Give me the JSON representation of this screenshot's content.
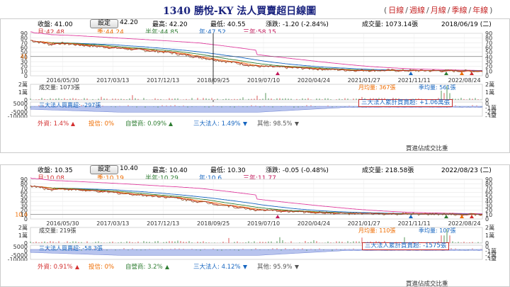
{
  "page": {
    "title": "1340 勝悅-KY 法人買賣超日線圖",
    "timeframes": [
      "日線",
      "週線",
      "月線",
      "季線",
      "年線"
    ]
  },
  "panels": [
    {
      "info": {
        "close": "收盤: 41.00",
        "open_value": "42.20",
        "high": "最高: 42.20",
        "low": "最低: 40.55",
        "change": "漲跌: -1.20 (-2.84%)",
        "volume": "成交量: 1073.14張",
        "date": "2018/06/19 (二)"
      },
      "ma": {
        "month": "月:42.48",
        "quarter": "季:44.24",
        "half": "半年:44.85",
        "year": "年:47.52",
        "three_year": "三年:58.15"
      },
      "price_label": "41",
      "y_ticks": [
        "90",
        "80",
        "70",
        "60",
        "50",
        "40",
        "30",
        "20",
        "10",
        "0"
      ],
      "dates": [
        "2016/05/30",
        "2017/03/13",
        "2017/12/13",
        "2018/09/25",
        "2019/07/10",
        "2020/04/24",
        "2021/01/27",
        "2021/11/11",
        "2022/08/24"
      ],
      "vol": {
        "label": "成交量: 1073張",
        "month_avg": "月均量: 367張",
        "quarter_avg": "季均量: 561張",
        "y": [
          "2萬",
          "1萬",
          "0"
        ]
      },
      "inst": {
        "label": "三大法人買賣超: -297張",
        "cum": "三大法人累計買賣超: +1.06萬張",
        "y": [
          "5000",
          "0",
          "-5000",
          "-10000",
          "-15000"
        ],
        "yr": [
          "0",
          "-1萬",
          "-2萬",
          "-3萬"
        ]
      },
      "bottom": {
        "foreign": "外資: 1.4%",
        "trust": "投信: 0%",
        "dealer": "自營商: 0.09%",
        "inst3": "三大法人: 1.49%",
        "others": "其他: 98.5%",
        "ratio": "買進佔成交比重"
      }
    },
    {
      "info": {
        "close": "收盤: 10.35",
        "open_value": "10.40",
        "high": "最高: 10.40",
        "low": "最低: 10.30",
        "change": "漲跌: -0.05 (-0.48%)",
        "volume": "成交量: 218.58張",
        "date": "2022/08/23 (二)"
      },
      "ma": {
        "month": "月:10.08",
        "quarter": "季:10.19",
        "half": "半年:10.29",
        "year": "年:10.6",
        "three_year": "三年:11.77"
      },
      "price_label": "10.4",
      "y_ticks": [
        "90",
        "80",
        "70",
        "60",
        "50",
        "40",
        "30",
        "20",
        "10",
        "0"
      ],
      "dates": [
        "2016/05/30",
        "2017/03/13",
        "2017/12/13",
        "2018/09/25",
        "2019/07/10",
        "2020/04/24",
        "2021/01/27",
        "2021/11/11",
        "2022/08/24"
      ],
      "vol": {
        "label": "成交量: 219張",
        "month_avg": "月均量: 110張",
        "quarter_avg": "季均量: 107張",
        "y": [
          "2萬",
          "1萬",
          "0"
        ]
      },
      "inst": {
        "label": "三大法人買賣超: -58.3張",
        "cum": "三大法人累計買賣超: -1575張",
        "y": [
          "5000",
          "0",
          "-5000",
          "-10000",
          "-15000"
        ],
        "yr": [
          "0",
          "-1萬",
          "-2萬",
          "-3萬"
        ]
      },
      "bottom": {
        "foreign": "外資: 0.91%",
        "trust": "投信: 0%",
        "dealer": "自營商: 3.2%",
        "inst3": "三大法人: 4.12%",
        "others": "其他: 95.9%",
        "ratio": "買進佔成交比重"
      }
    }
  ],
  "common": {
    "set_label": "設定"
  },
  "colors": {
    "month_ma": "#d32f2f",
    "quarter_ma": "#ef6c00",
    "half_ma": "#2e7d32",
    "year_ma": "#1565c0",
    "three_year_ma": "#e040a0",
    "price": "#8a5a2b",
    "inst_fill": "#b8c4ee"
  }
}
